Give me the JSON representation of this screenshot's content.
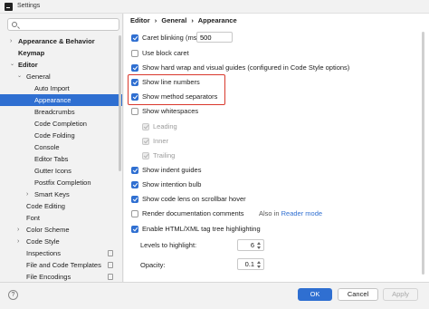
{
  "window": {
    "title": "Settings"
  },
  "search": {
    "placeholder": "",
    "value": ""
  },
  "sidebar": {
    "items": [
      {
        "label": "Appearance & Behavior",
        "chevron": "›"
      },
      {
        "label": "Keymap"
      },
      {
        "label": "Editor",
        "chevron": "⌄"
      },
      {
        "label": "General",
        "chevron": "⌄"
      },
      {
        "label": "Auto Import"
      },
      {
        "label": "Appearance"
      },
      {
        "label": "Breadcrumbs"
      },
      {
        "label": "Code Completion"
      },
      {
        "label": "Code Folding"
      },
      {
        "label": "Console"
      },
      {
        "label": "Editor Tabs"
      },
      {
        "label": "Gutter Icons"
      },
      {
        "label": "Postfix Completion"
      },
      {
        "label": "Smart Keys",
        "chevron": "›"
      },
      {
        "label": "Code Editing"
      },
      {
        "label": "Font"
      },
      {
        "label": "Color Scheme",
        "chevron": "›"
      },
      {
        "label": "Code Style",
        "chevron": "›"
      },
      {
        "label": "Inspections"
      },
      {
        "label": "File and Code Templates"
      },
      {
        "label": "File Encodings"
      }
    ]
  },
  "breadcrumb": {
    "part1": "Editor",
    "sep1": "›",
    "part2": "General",
    "sep2": "›",
    "part3": "Appearance"
  },
  "options": {
    "caret_blinking": {
      "label": "Caret blinking (ms):",
      "value": "500",
      "checked": true
    },
    "block_caret": {
      "label": "Use block caret",
      "checked": false
    },
    "hard_wrap": {
      "label": "Show hard wrap and visual guides (configured in Code Style options)",
      "checked": true
    },
    "line_numbers": {
      "label": "Show line numbers",
      "checked": true
    },
    "method_separators": {
      "label": "Show method separators",
      "checked": true
    },
    "whitespaces": {
      "label": "Show whitespaces",
      "checked": false
    },
    "leading": {
      "label": "Leading",
      "checked": true
    },
    "inner": {
      "label": "Inner",
      "checked": true
    },
    "trailing": {
      "label": "Trailing",
      "checked": true
    },
    "indent_guides": {
      "label": "Show indent guides",
      "checked": true
    },
    "intention_bulb": {
      "label": "Show intention bulb",
      "checked": true
    },
    "code_lens": {
      "label": "Show code lens on scrollbar hover",
      "checked": true
    },
    "render_docs": {
      "label": "Render documentation comments",
      "checked": false,
      "note": "Also in",
      "link": "Reader mode"
    },
    "tag_tree": {
      "label": "Enable HTML/XML tag tree highlighting",
      "checked": true
    },
    "levels": {
      "label": "Levels to highlight:",
      "value": "6"
    },
    "opacity": {
      "label": "Opacity:",
      "value": "0.1"
    }
  },
  "footer": {
    "help": "?",
    "ok": "OK",
    "cancel": "Cancel",
    "apply": "Apply"
  },
  "colors": {
    "accent": "#2f6fd1",
    "highlight_box": "#d9382c"
  }
}
